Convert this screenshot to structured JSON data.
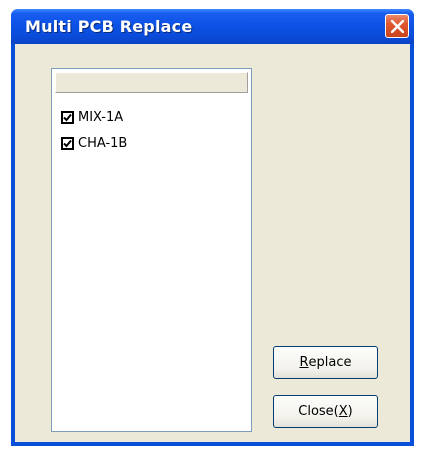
{
  "window": {
    "title": "Multi PCB Replace"
  },
  "list": {
    "header": "",
    "items": [
      {
        "label": "MIX-1A",
        "checked": true
      },
      {
        "label": "CHA-1B",
        "checked": true
      }
    ]
  },
  "buttons": {
    "replace": {
      "mnemonic": "R",
      "rest": "eplace"
    },
    "close": {
      "prefix": "Close(",
      "mnemonic": "X",
      "suffix": ")"
    }
  },
  "icons": {
    "close": "close-x-icon",
    "checkbox": "checkmark-icon"
  },
  "colors": {
    "titlebar": "#0a4bd8",
    "close_button": "#e0582f",
    "dialog_bg": "#ece9d8"
  }
}
